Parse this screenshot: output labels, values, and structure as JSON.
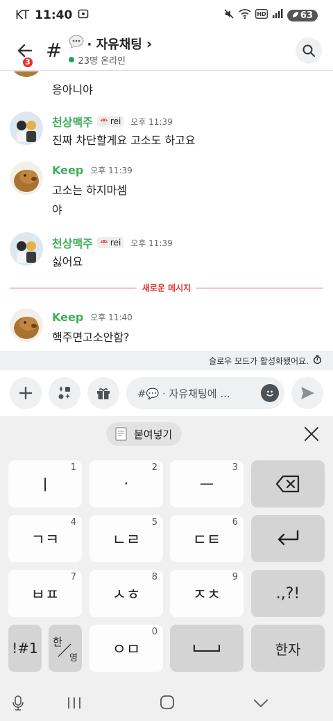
{
  "status": {
    "carrier": "KT",
    "time": "11:40",
    "battery": "63"
  },
  "header": {
    "back_badge": "3",
    "hash": "#",
    "channel_name": "· 자유채팅",
    "channel_chevron": "›",
    "online_count": "23명 온라인"
  },
  "messages": [
    {
      "text": "응아니야"
    },
    {
      "author": "천상맥주",
      "tag": "rei",
      "time": "오후 11:39",
      "lines": [
        "진짜 차단할게요 고소도 하고요"
      ]
    },
    {
      "author": "Keep",
      "time": "오후 11:39",
      "lines": [
        "고소는 하지마셈",
        "야"
      ]
    },
    {
      "author": "천상맥주",
      "tag": "rei",
      "time": "오후 11:39",
      "lines": [
        "싫어요"
      ]
    },
    {
      "divider": "새로운 메시지"
    },
    {
      "author": "Keep",
      "time": "오후 11:40",
      "lines": [
        "핵주면고소안함?"
      ]
    }
  ],
  "slow_mode": "슬로우 모드가 활성화됐어요.",
  "composer": {
    "placeholder": "#💬 · 자유채팅에 ..."
  },
  "keyboard": {
    "paste_label": "붙여넣기",
    "keys": [
      {
        "label": "ㅣ",
        "num": "1"
      },
      {
        "label": "·",
        "num": "2"
      },
      {
        "label": "ㅡ",
        "num": "3"
      },
      {
        "label": "ㄱㅋ",
        "num": "4"
      },
      {
        "label": "ㄴㄹ",
        "num": "5"
      },
      {
        "label": "ㄷㅌ",
        "num": "6"
      },
      {
        "label": "ㅂㅍ",
        "num": "7"
      },
      {
        "label": "ㅅㅎ",
        "num": "8"
      },
      {
        "label": "ㅈㅊ",
        "num": "9"
      },
      {
        "label": ".,?!"
      },
      {
        "label": "!#1"
      },
      {
        "label": "ㅇㅁ",
        "num": "0"
      },
      {
        "label": "한자"
      }
    ],
    "lang_top": "한",
    "lang_bottom": "영"
  }
}
